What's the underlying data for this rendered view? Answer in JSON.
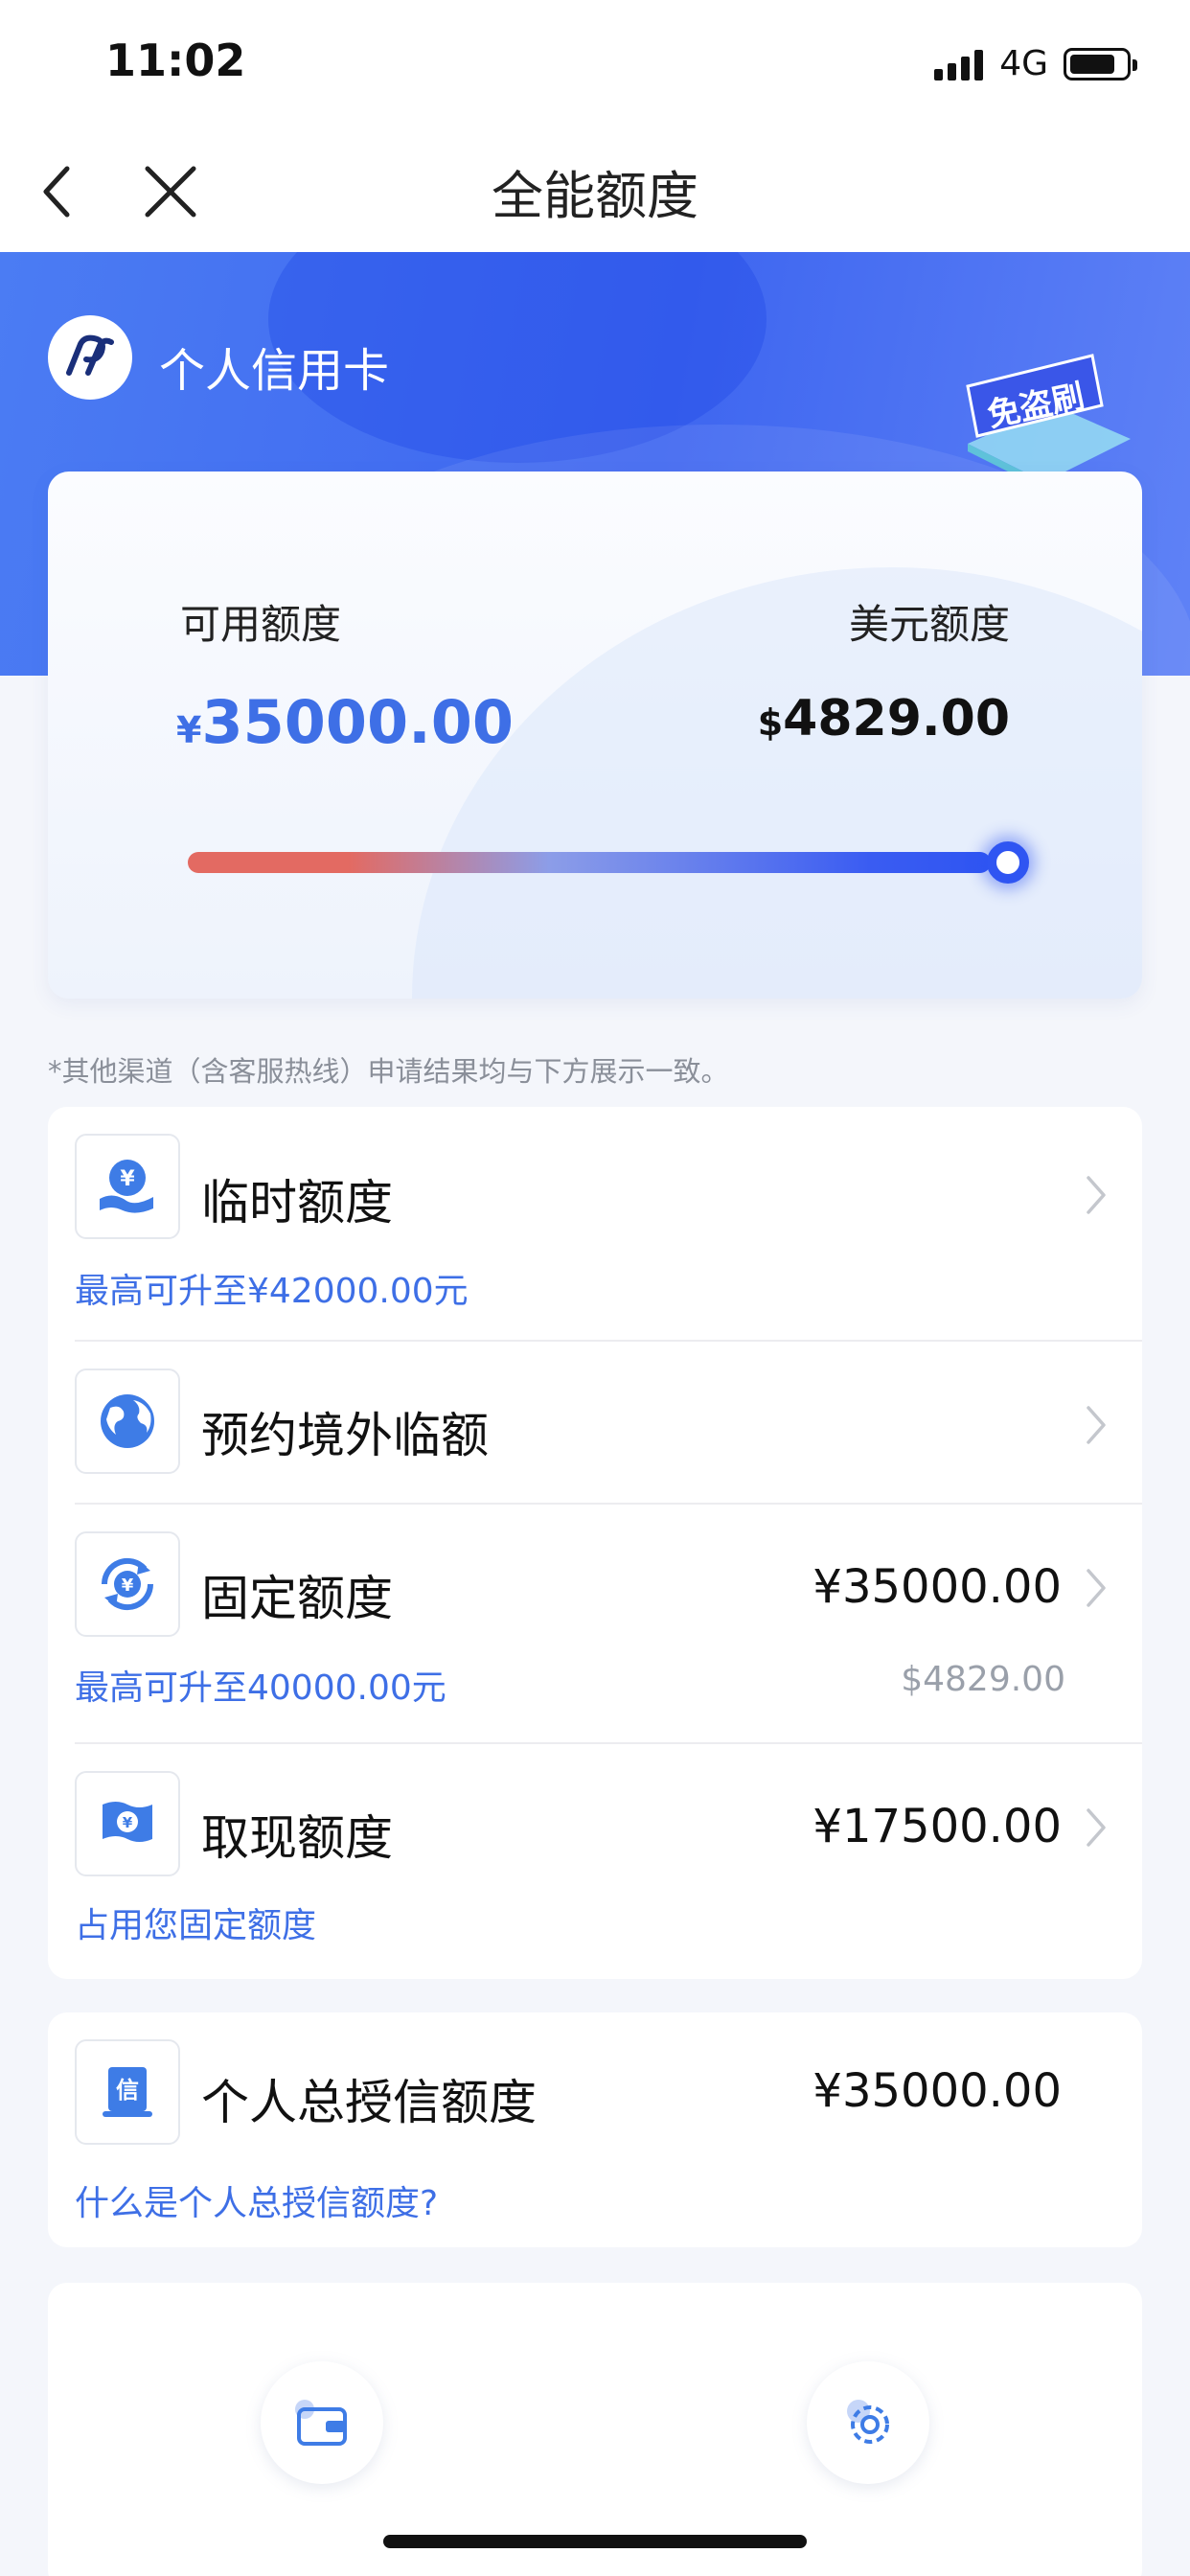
{
  "status_bar": {
    "time": "11:02",
    "network": "4G"
  },
  "nav": {
    "title": "全能额度"
  },
  "hero": {
    "card_name": "个人信用卡"
  },
  "quota": {
    "available_label": "可用额度",
    "available_currency": "¥",
    "available_amount": "35000.00",
    "usd_label": "美元额度",
    "usd_currency": "$",
    "usd_amount": "4829.00",
    "slider_level": 1.0
  },
  "note": "*其他渠道（含客服热线）申请结果均与下方展示一致。",
  "items": [
    {
      "title": "临时额度",
      "value": "",
      "sub": "最高可升至¥42000.00元",
      "sub_right": ""
    },
    {
      "title": "预约境外临额",
      "value": "",
      "sub": "",
      "sub_right": ""
    },
    {
      "title": "固定额度",
      "value": "¥35000.00",
      "sub": "最高可升至40000.00元",
      "sub_right": "$4829.00"
    },
    {
      "title": "取现额度",
      "value": "¥17500.00",
      "sub": "占用您固定额度",
      "sub_right": ""
    }
  ],
  "credit": {
    "title": "个人总授信额度",
    "value": "¥35000.00",
    "link": "什么是个人总授信额度?",
    "icon_char": "信"
  },
  "colors": {
    "brand_blue": "#3e6fe6",
    "hero_blue": "#4b7cf3",
    "slider_start": "#e36a62",
    "slider_end": "#2f55f2"
  },
  "icons": [
    "back-icon",
    "close-icon",
    "bank-logo",
    "anti-theft-badge",
    "temp-quota-icon",
    "globe-icon",
    "fixed-quota-icon",
    "cash-icon",
    "credit-icon",
    "wallet-icon",
    "gear-icon",
    "chevron-right-icon"
  ]
}
